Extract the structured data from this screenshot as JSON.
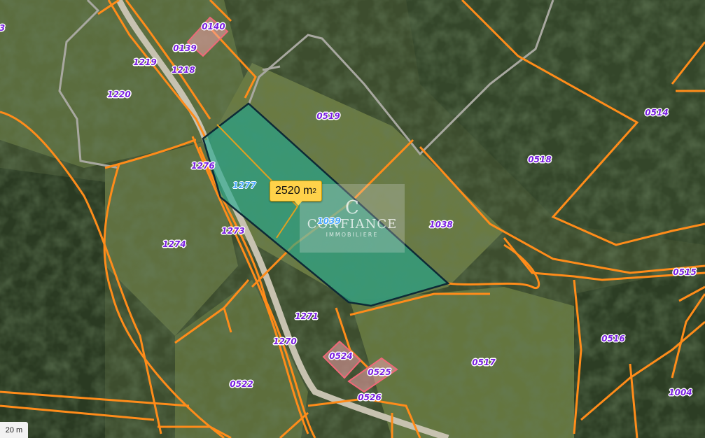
{
  "map": {
    "selected_area": {
      "value": "2520",
      "unit": "m",
      "exponent": "2"
    },
    "scale_label": "20 m",
    "watermark": {
      "mark": "C",
      "name": "CONFIANCE",
      "tagline": "IMMOBILIERE"
    },
    "colors": {
      "parcel_border": "#ff8c1a",
      "path_border": "#a8a8a0",
      "selected_fill": "#1fa890",
      "building_fill": "#f0a0a8",
      "label_text": "#7a1fe0",
      "area_tag": "#ffd24a"
    },
    "parcel_labels": [
      {
        "text": "3"
      },
      {
        "text": "0140"
      },
      {
        "text": "0139"
      },
      {
        "text": "1219"
      },
      {
        "text": "1218"
      },
      {
        "text": "1220"
      },
      {
        "text": "0519"
      },
      {
        "text": "0514"
      },
      {
        "text": "0518"
      },
      {
        "text": "1276"
      },
      {
        "text": "1277"
      },
      {
        "text": "1039"
      },
      {
        "text": "1038"
      },
      {
        "text": "1273"
      },
      {
        "text": "1274"
      },
      {
        "text": "0515"
      },
      {
        "text": "1271"
      },
      {
        "text": "0516"
      },
      {
        "text": "1270"
      },
      {
        "text": "0524"
      },
      {
        "text": "0517"
      },
      {
        "text": "0525"
      },
      {
        "text": "0522"
      },
      {
        "text": "0526"
      },
      {
        "text": "1004"
      }
    ]
  }
}
